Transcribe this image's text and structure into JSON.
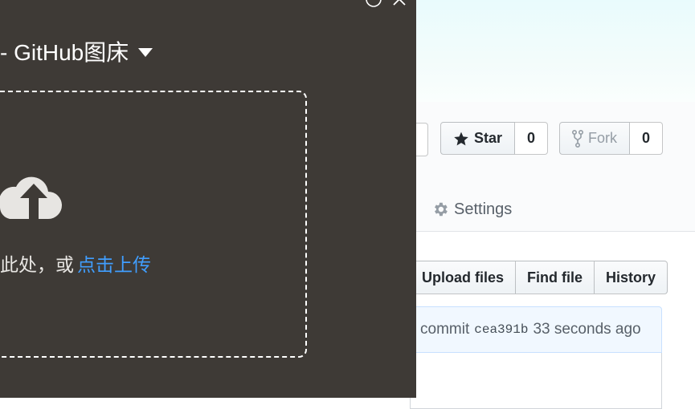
{
  "repo": {
    "star_label": "Star",
    "star_count": "0",
    "fork_label": "Fork",
    "fork_count": "0",
    "settings_tab": "Settings"
  },
  "file_actions": [
    "Upload files",
    "Find file",
    "History"
  ],
  "commit": {
    "prefix": "commit",
    "sha": "cea391b",
    "time": "33 seconds ago"
  },
  "upload_panel": {
    "title": "- GitHub图床",
    "drop_text": "此处，或",
    "drop_link": "点击上传",
    "accent_color": "#409eff",
    "background_color": "#3e3a36"
  },
  "icons": [
    "star-icon",
    "fork-icon",
    "gear-icon",
    "cloud-upload-icon",
    "chevron-down-icon",
    "info-icon",
    "close-icon"
  ]
}
